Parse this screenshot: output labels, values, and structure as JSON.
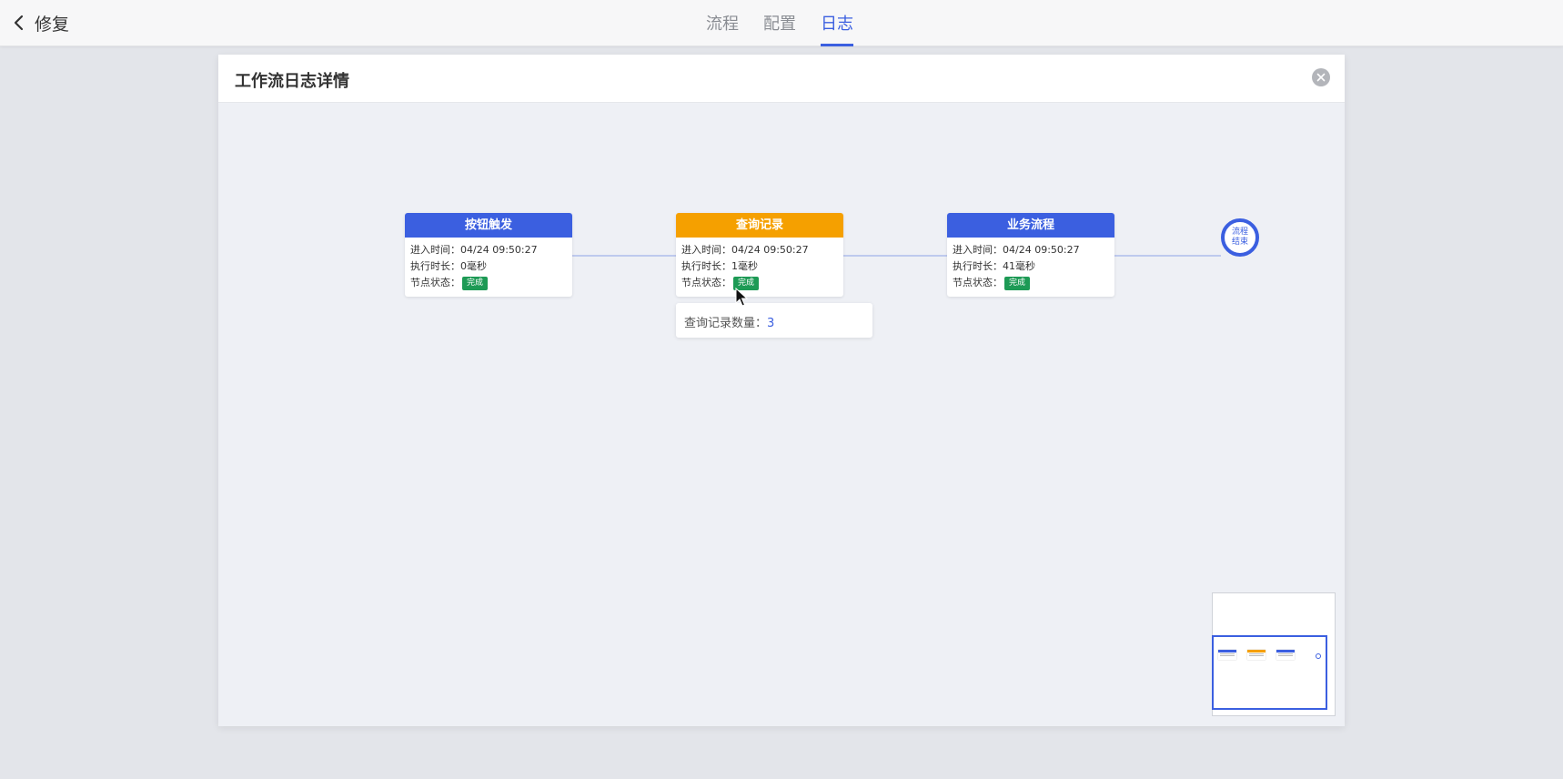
{
  "header": {
    "back_label": "修复",
    "tabs": [
      {
        "label": "流程"
      },
      {
        "label": "配置"
      },
      {
        "label": "日志"
      }
    ],
    "active_tab": "日志"
  },
  "dialog": {
    "title": "工作流日志详情"
  },
  "colors": {
    "accent": "#3b5fe0",
    "query_node": "#f5a000",
    "status_done": "#1d9a55"
  },
  "labels": {
    "enter_time": "进入时间：",
    "duration": "执行时长：",
    "status": "节点状态："
  },
  "nodes": [
    {
      "title": "按钮触发",
      "enter_time": "04/24 09:50:27",
      "duration": "0毫秒",
      "status": "完成"
    },
    {
      "title": "查询记录",
      "enter_time": "04/24 09:50:27",
      "duration": "1毫秒",
      "status": "完成"
    },
    {
      "title": "业务流程",
      "enter_time": "04/24 09:50:27",
      "duration": "41毫秒",
      "status": "完成"
    }
  ],
  "end_node": {
    "line1": "流程",
    "line2": "结束"
  },
  "tooltip": {
    "label": "查询记录数量：",
    "value": "3"
  }
}
